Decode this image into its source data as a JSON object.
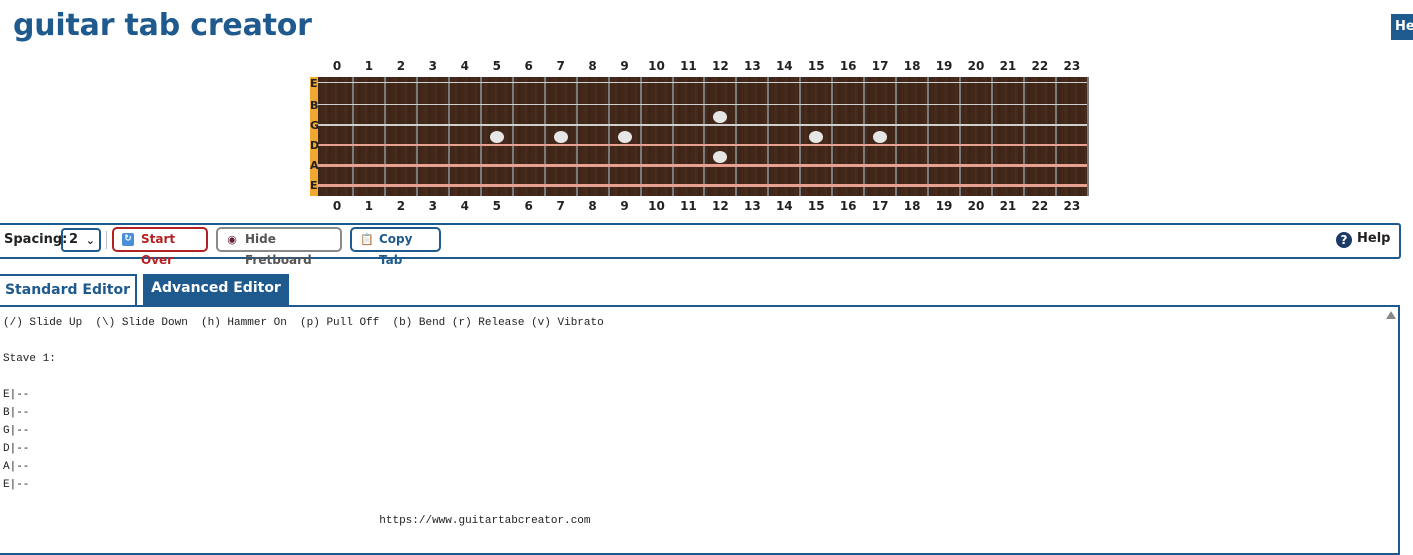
{
  "app": {
    "title": "guitar tab creator",
    "corner_help": "Help"
  },
  "fretboard": {
    "frets": [
      "0",
      "1",
      "2",
      "3",
      "4",
      "5",
      "6",
      "7",
      "8",
      "9",
      "10",
      "11",
      "12",
      "13",
      "14",
      "15",
      "16",
      "17",
      "18",
      "19",
      "20",
      "21",
      "22",
      "23"
    ],
    "strings": [
      "E",
      "B",
      "G",
      "D",
      "A",
      "E"
    ],
    "markers_single": [
      5,
      7,
      9,
      15,
      17
    ],
    "markers_double": [
      12
    ],
    "colors": {
      "wood": "#3b2418",
      "nut": "#f0a830",
      "marker": "#e6e6e6"
    }
  },
  "toolbar": {
    "spacing_label": "Spacing:",
    "spacing_value": "2",
    "start_over": "Start Over",
    "hide_fretboard": "Hide Fretboard",
    "copy_tab": "Copy Tab",
    "help": "Help"
  },
  "tabs": [
    {
      "label": "Standard Editor",
      "active": false
    },
    {
      "label": "Advanced Editor",
      "active": true
    }
  ],
  "editor": {
    "legend": "(/) Slide Up  (\\) Slide Down  (h) Hammer On  (p) Pull Off  (b) Bend (r) Release (v) Vibrato",
    "stave": "Stave 1:",
    "lines": [
      "E|--",
      "B|--",
      "G|--",
      "D|--",
      "A|--",
      "E|--"
    ],
    "url": "https://www.guitartabcreator.com"
  },
  "colors": {
    "brand": "#1f5a8e",
    "danger": "#b22222"
  }
}
